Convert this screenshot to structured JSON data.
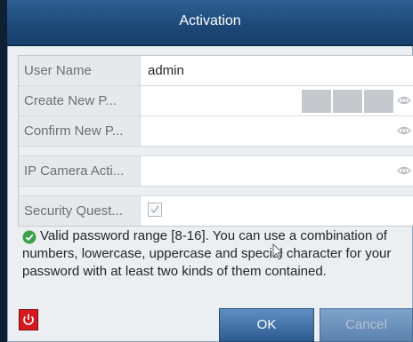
{
  "dialog": {
    "title": "Activation"
  },
  "form": {
    "user_name": {
      "label": "User Name",
      "value": "admin"
    },
    "create_password": {
      "label": "Create New P...",
      "value": "",
      "show_icon": "eye-icon"
    },
    "confirm_password": {
      "label": "Confirm New P...",
      "value": "",
      "show_icon": "eye-icon"
    },
    "ip_camera_activation": {
      "label": "IP Camera Acti...",
      "value": "",
      "show_icon": "eye-icon"
    },
    "security_question": {
      "label": "Security Quest...",
      "checked": true
    }
  },
  "tip": {
    "icon": "check-circle-icon",
    "text": "Valid password range [8-16]. You can use a combination of numbers, lowercase, uppercase and special character for your password with at least two kinds of them contained."
  },
  "buttons": {
    "power_icon": "power-icon",
    "ok": "OK",
    "cancel": "Cancel"
  },
  "colors": {
    "title_bar": "#1d4a7a",
    "tip_icon": "#3aa14a",
    "power_button": "#d4191f"
  }
}
